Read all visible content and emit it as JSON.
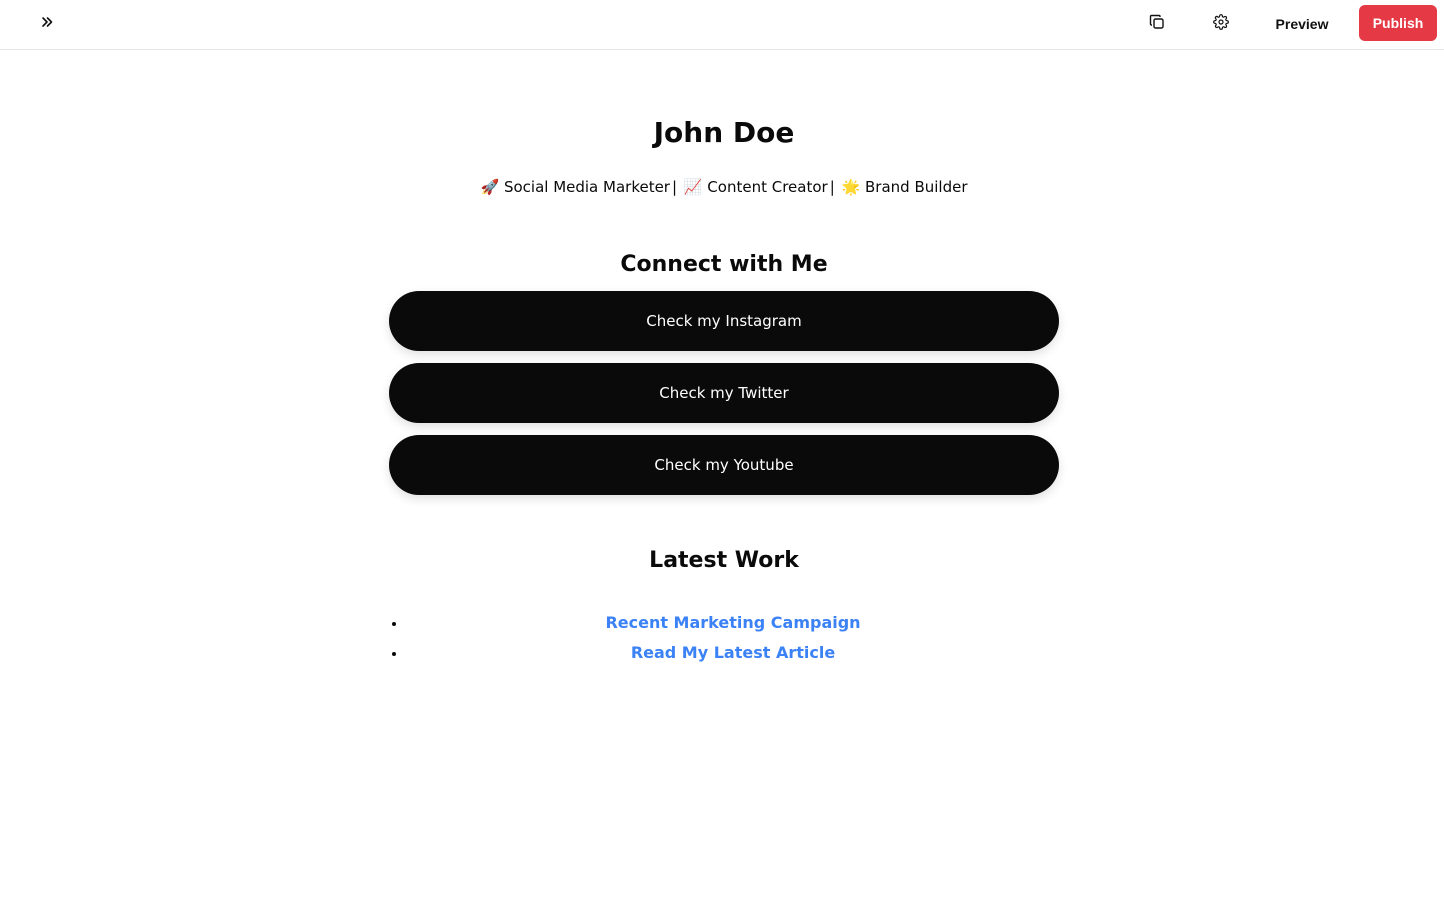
{
  "toolbar": {
    "expand_icon": "chevrons-right-icon",
    "copy_icon": "copy-icon",
    "settings_icon": "gear-icon",
    "preview_label": "Preview",
    "publish_label": "Publish",
    "publish_color": "#e63946"
  },
  "profile": {
    "name": "John Doe",
    "tagline": {
      "part1_emoji": "🚀",
      "part1": "Social Media Marketer",
      "separator": "|",
      "part2_emoji": "📈",
      "part2": "Content Creator",
      "part3_emoji": "🌟",
      "part3": "Brand Builder"
    }
  },
  "connect": {
    "title": "Connect with Me",
    "buttons": [
      {
        "label": "Check my Instagram"
      },
      {
        "label": "Check my Twitter"
      },
      {
        "label": "Check my Youtube"
      }
    ],
    "button_color": "#0a0a0a"
  },
  "work": {
    "title": "Latest Work",
    "links": [
      {
        "label": "Recent Marketing Campaign"
      },
      {
        "label": "Read My Latest Article"
      }
    ],
    "link_color": "#3b82f6"
  }
}
